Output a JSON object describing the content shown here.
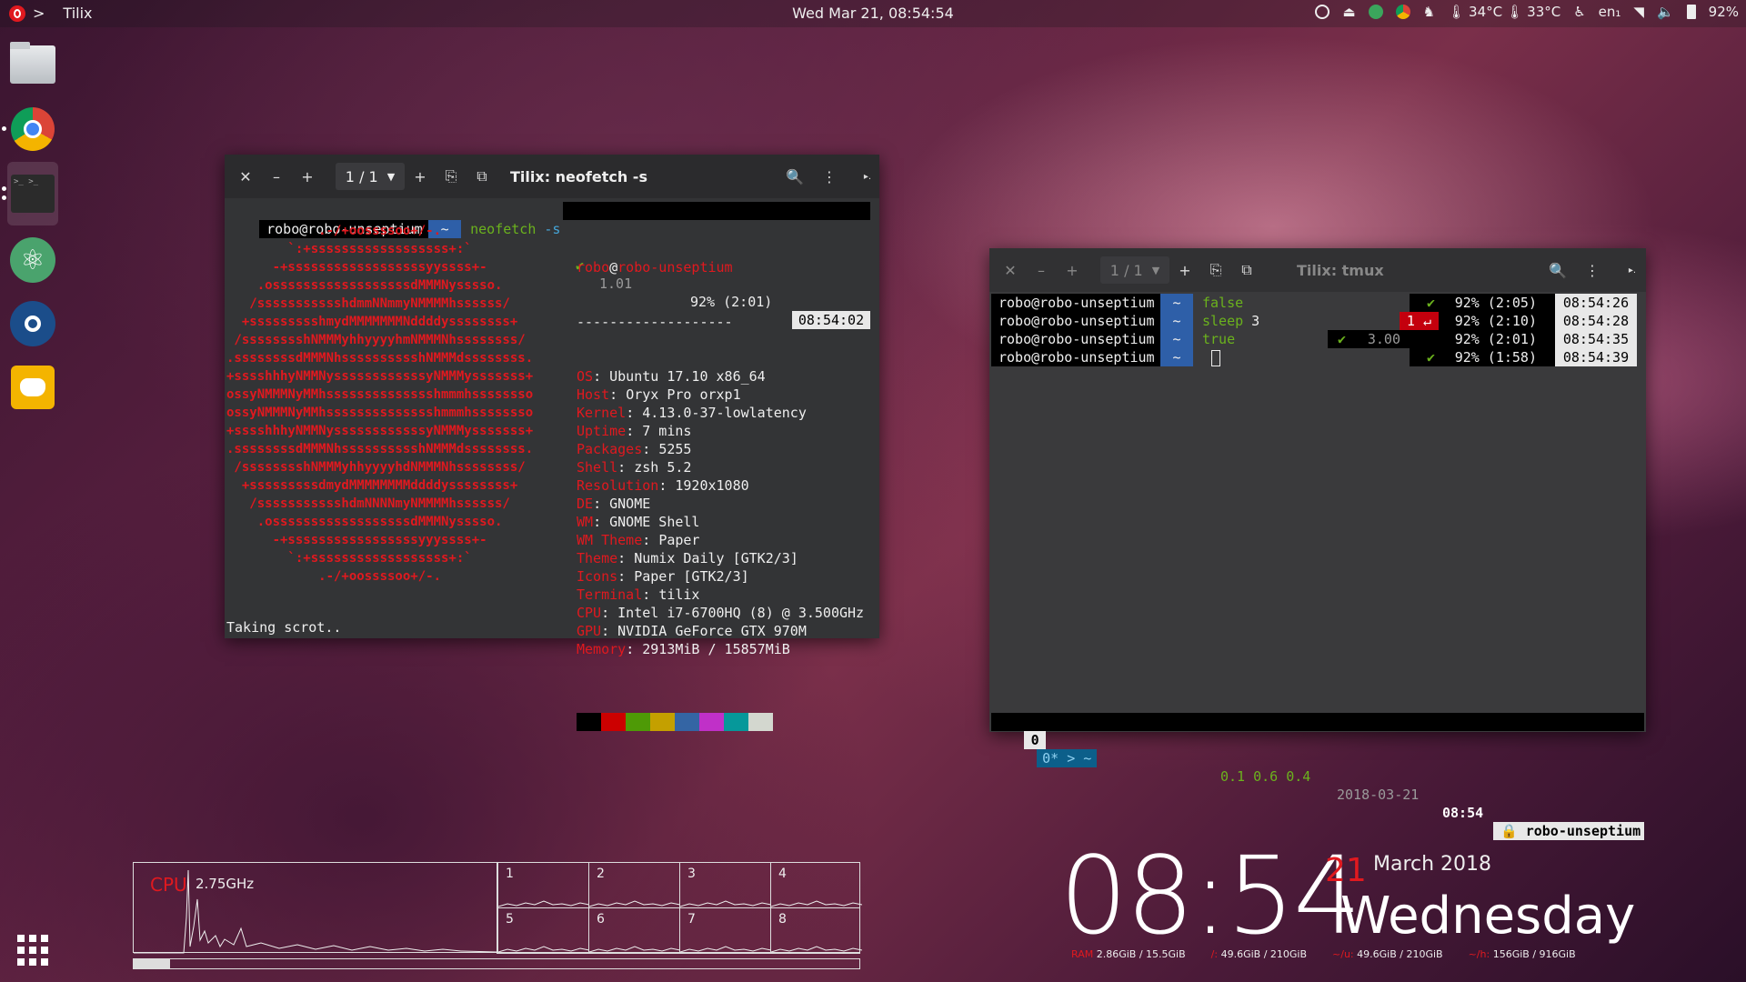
{
  "topbar": {
    "app_name": "Tilix",
    "activities_arrow": ">",
    "clock": "Wed Mar 21, 08:54:54",
    "temp1": "34°C",
    "temp2": "33°C",
    "keyboard": "en₁",
    "battery": "92%"
  },
  "dock": {
    "items": [
      "files-icon",
      "chrome-icon",
      "terminal-icon",
      "atom-icon",
      "steam-icon",
      "discord-icon"
    ],
    "apps_grid": "show-applications-icon"
  },
  "win1": {
    "page": "1 / 1",
    "title": "Tilix: neofetch -s",
    "prompt_user": "robo@robo-unseptium",
    "prompt_dir": "~",
    "cmd": "neofetch",
    "cmd_arg": "-s",
    "status_check": "✔",
    "load": "1.01",
    "battery": "92% (2:01)",
    "time": "08:54:02",
    "host_user": "robo",
    "host_at": "@",
    "host_name": "robo-unseptium",
    "separator": "-------------------",
    "info": [
      {
        "k": "OS",
        "v": "Ubuntu 17.10 x86_64"
      },
      {
        "k": "Host",
        "v": "Oryx Pro orxp1"
      },
      {
        "k": "Kernel",
        "v": "4.13.0-37-lowlatency"
      },
      {
        "k": "Uptime",
        "v": "7 mins"
      },
      {
        "k": "Packages",
        "v": "5255"
      },
      {
        "k": "Shell",
        "v": "zsh 5.2"
      },
      {
        "k": "Resolution",
        "v": "1920x1080"
      },
      {
        "k": "DE",
        "v": "GNOME"
      },
      {
        "k": "WM",
        "v": "GNOME Shell"
      },
      {
        "k": "WM Theme",
        "v": "Paper"
      },
      {
        "k": "Theme",
        "v": "Numix Daily [GTK2/3]"
      },
      {
        "k": "Icons",
        "v": "Paper [GTK2/3]"
      },
      {
        "k": "Terminal",
        "v": "tilix"
      },
      {
        "k": "CPU",
        "v": "Intel i7-6700HQ (8) @ 3.500GHz"
      },
      {
        "k": "GPU",
        "v": "NVIDIA GeForce GTX 970M"
      },
      {
        "k": "Memory",
        "v": "2913MiB / 15857MiB"
      }
    ],
    "logo": [
      "            .-/+oossssoo+/-.",
      "        `:+ssssssssssssssssss+:`",
      "      -+ssssssssssssssssssyyssss+-",
      "    .ossssssssssssssssssdMMMNysssso.",
      "   /ssssssssssshdmmNNmmyNMMMMhssssss/",
      "  +ssssssssshmydMMMMMMMNddddyssssssss+",
      " /sssssssshNMMMyhhyyyyhmNMMMNhssssssss/",
      ".ssssssssdMMMNhsssssssssshNMMMdssssssss.",
      "+sssshhhyNMMNyssssssssssssyNMMMysssssss+",
      "ossyNMMMNyMMhsssssssssssssshmmmhssssssso",
      "ossyNMMMNyMMhsssssssssssssshmmmhssssssso",
      "+sssshhhyNMMNyssssssssssssyNMMMysssssss+",
      ".ssssssssdMMMNhsssssssssshNMMMdssssssss.",
      " /sssssssshNMMMyhhyyyyhdNMMMNhssssssss/",
      "  +sssssssssdmydMMMMMMMMddddyssssssss+",
      "   /ssssssssssshdmNNNNmyNMMMMhssssss/",
      "    .ossssssssssssssssssdMMMNysssso.",
      "      -+sssssssssssssssssyyyssss+-",
      "        `:+ssssssssssssssssss+:`",
      "            .-/+oossssoo+/-."
    ],
    "palette": [
      "#000000",
      "#cc0000",
      "#4e9a06",
      "#c4a000",
      "#3465a4",
      "#c030c8",
      "#06989a",
      "#d3d7cf"
    ],
    "footer": "Taking scrot.."
  },
  "win2": {
    "page": "1 / 1",
    "title": "Tilix: tmux",
    "lines": [
      {
        "user": "robo@robo-unseptium",
        "dir": "~",
        "cmd": "false",
        "arg": "",
        "status": "✔",
        "load": "",
        "bat": "92% (2:05)",
        "time": "08:54:26"
      },
      {
        "user": "robo@robo-unseptium",
        "dir": "~",
        "cmd": "sleep",
        "arg": "3",
        "status": "1 ↵",
        "load": "",
        "bat": "92% (2:10)",
        "time": "08:54:28"
      },
      {
        "user": "robo@robo-unseptium",
        "dir": "~",
        "cmd": "true",
        "arg": "",
        "status": "✔",
        "load": "3.00",
        "bat": "92% (2:01)",
        "time": "08:54:35"
      },
      {
        "user": "robo@robo-unseptium",
        "dir": "~",
        "cmd": "",
        "arg": "",
        "status": "✔",
        "load": "",
        "bat": "92% (1:58)",
        "time": "08:54:39"
      }
    ],
    "tmux_session": "0",
    "tmux_window": "0* > ~",
    "tmux_load": "0.1 0.6 0.4",
    "tmux_date": "2018-03-21",
    "tmux_time": "08:54",
    "tmux_host": "robo-unseptium"
  },
  "cpu_widget": {
    "label": "CPU",
    "freq": "2.75GHz",
    "cores": [
      "1",
      "2",
      "3",
      "4",
      "5",
      "6",
      "7",
      "8"
    ],
    "usage_fraction": 0.05
  },
  "desk_clock": {
    "time": "08:54",
    "day": "21",
    "month_year": "March 2018",
    "weekday": "Wednesday"
  },
  "disks": [
    {
      "label": "RAM",
      "value": "2.86GiB / 15.5GiB"
    },
    {
      "label": "/:",
      "value": "49.6GiB / 210GiB"
    },
    {
      "label": "~/u:",
      "value": "49.6GiB / 210GiB"
    },
    {
      "label": "~/h:",
      "value": "156GiB / 916GiB"
    }
  ]
}
